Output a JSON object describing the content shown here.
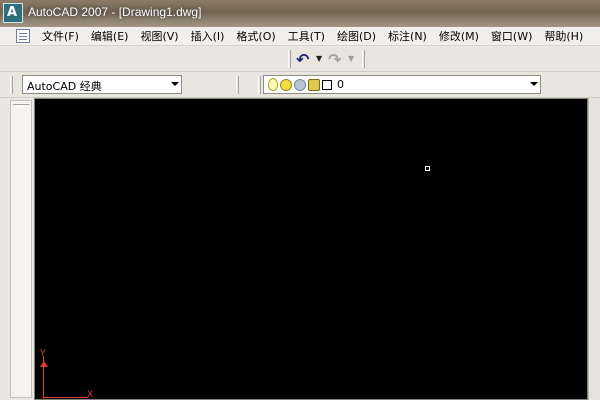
{
  "window": {
    "title": "AutoCAD 2007 - [Drawing1.dwg]",
    "app_icon": "autocad-app-icon",
    "app_icon_glyph": "A"
  },
  "menu": {
    "items": [
      {
        "label": "文件(F)"
      },
      {
        "label": "编辑(E)"
      },
      {
        "label": "视图(V)"
      },
      {
        "label": "插入(I)"
      },
      {
        "label": "格式(O)"
      },
      {
        "label": "工具(T)"
      },
      {
        "label": "绘图(D)"
      },
      {
        "label": "标注(N)"
      },
      {
        "label": "修改(M)"
      },
      {
        "label": "窗口(W)"
      },
      {
        "label": "帮助(H)"
      }
    ]
  },
  "toolbar": {
    "undo_icon": "undo-icon",
    "redo_icon": "redo-icon",
    "undo_glyph": "↶",
    "redo_glyph": "↷",
    "dropdown_glyph": "▼"
  },
  "workspace": {
    "selected": "AutoCAD 经典"
  },
  "layer": {
    "selected": "0",
    "icons": [
      "bulb-icon",
      "sun-icon",
      "cloud-icon",
      "lock-icon",
      "color-swatch-icon"
    ]
  },
  "ucs": {
    "x_label": "X",
    "y_label": "Y"
  },
  "colors": {
    "canvas_bg": "#000000",
    "ucs": "#e23a2e",
    "cursor": "#ffffff"
  }
}
